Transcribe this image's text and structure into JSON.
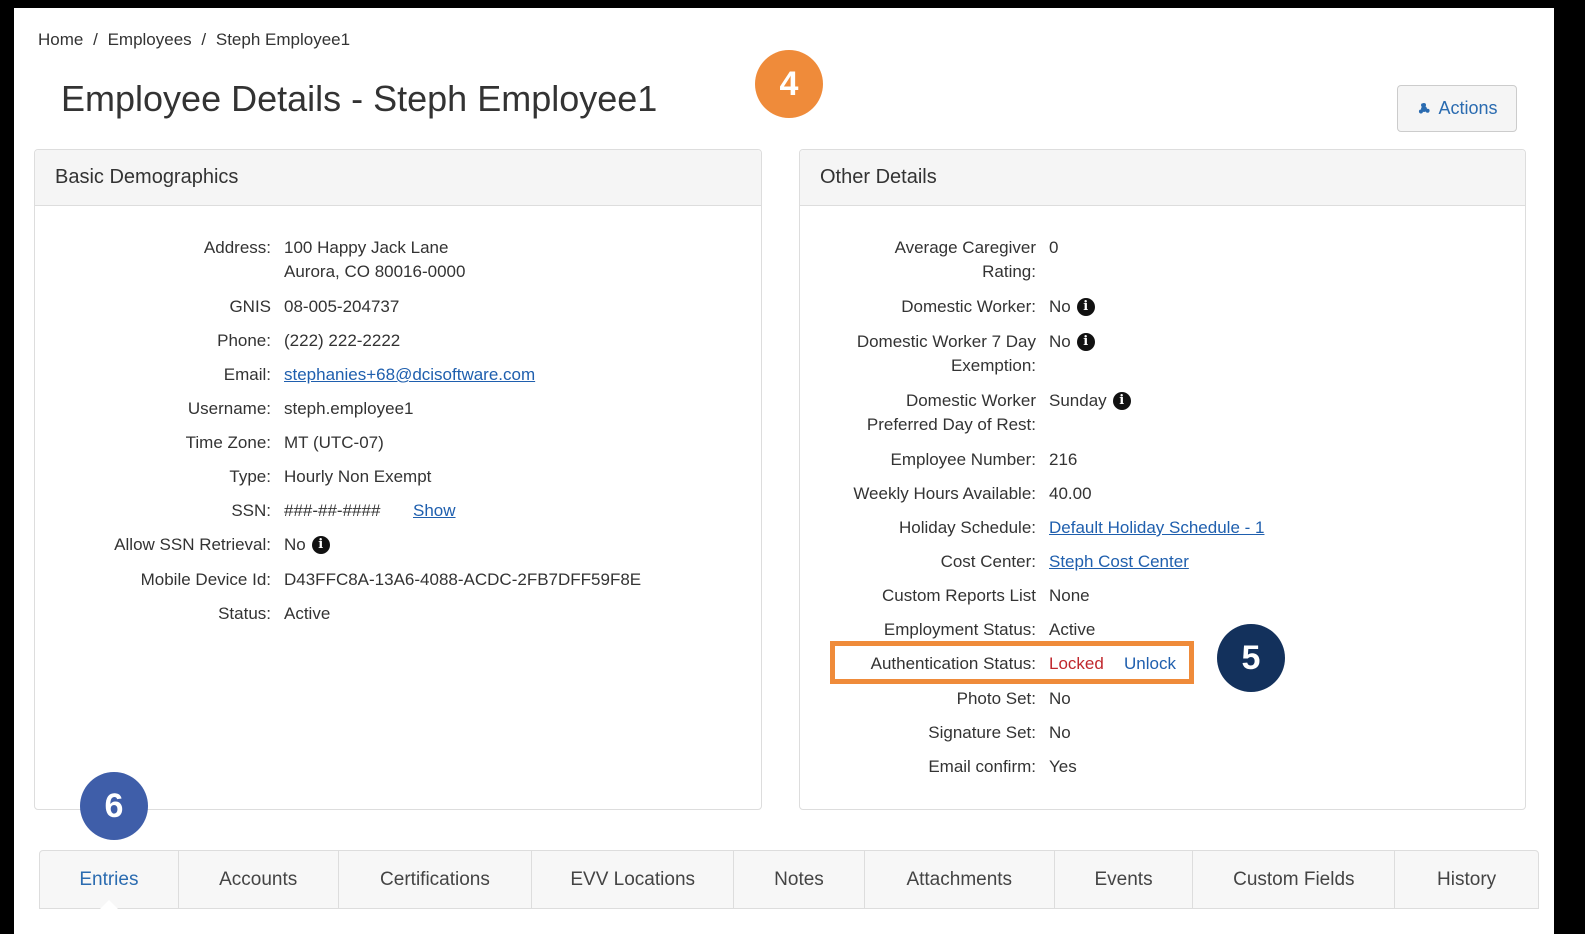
{
  "breadcrumb": [
    "Home",
    "/",
    "Employees",
    "/",
    "Steph Employee1"
  ],
  "page_title": "Employee Details - Steph Employee1",
  "actions_label": "Actions",
  "badges": {
    "four": "4",
    "five": "5",
    "six": "6"
  },
  "left_panel": {
    "title": "Basic Demographics",
    "address_label": "Address:",
    "address_line1": "100 Happy Jack Lane",
    "address_line2": "Aurora, CO 80016-0000",
    "gnis_label": "GNIS",
    "gnis_value": "08-005-204737",
    "phone_label": "Phone:",
    "phone_value": "(222) 222-2222",
    "email_label": "Email:",
    "email_value": "stephanies+68@dcisoftware.com",
    "username_label": "Username:",
    "username_value": "steph.employee1",
    "timezone_label": "Time Zone:",
    "timezone_value": "MT (UTC-07)",
    "type_label": "Type:",
    "type_value": "Hourly Non Exempt",
    "ssn_label": "SSN:",
    "ssn_value": "###-##-####",
    "ssn_show": "Show",
    "allow_ssn_label": "Allow SSN Retrieval:",
    "allow_ssn_value": "No",
    "mobile_label": "Mobile Device Id:",
    "mobile_value": "D43FFC8A-13A6-4088-ACDC-2FB7DFF59F8E",
    "status_label": "Status:",
    "status_value": "Active"
  },
  "right_panel": {
    "title": "Other Details",
    "avg_rating_label_1": "Average Caregiver",
    "avg_rating_label_2": "Rating:",
    "avg_rating_value": "0",
    "domestic_label": "Domestic Worker:",
    "domestic_value": "No",
    "dw7_label_1": "Domestic Worker 7 Day",
    "dw7_label_2": "Exemption:",
    "dw7_value": "No",
    "dwrest_label_1": "Domestic Worker",
    "dwrest_label_2": "Preferred Day of Rest:",
    "dwrest_value": "Sunday",
    "empnum_label": "Employee Number:",
    "empnum_value": "216",
    "weekly_label": "Weekly Hours Available:",
    "weekly_value": "40.00",
    "holiday_label": "Holiday Schedule:",
    "holiday_value": "Default Holiday Schedule - 1",
    "cost_label": "Cost Center:",
    "cost_value": "Steph Cost Center",
    "custom_reports_label": "Custom Reports List",
    "custom_reports_value": "None",
    "employment_label": "Employment Status:",
    "employment_value": "Active",
    "auth_label": "Authentication Status:",
    "auth_value": "Locked",
    "auth_unlock": "Unlock",
    "photo_label": "Photo Set:",
    "photo_value": "No",
    "signature_label": "Signature Set:",
    "signature_value": "No",
    "emailconf_label": "Email confirm:",
    "emailconf_value": "Yes"
  },
  "info_glyph": "i",
  "tabs": [
    "Entries",
    "Accounts",
    "Certifications",
    "EVV Locations",
    "Notes",
    "Attachments",
    "Events",
    "Custom Fields",
    "History"
  ],
  "colors": {
    "accent": "#2a6bb0",
    "locked": "#c0272d",
    "highlight": "#ef8b3a",
    "badge_dark": "#13315c",
    "badge_blue": "#3f5ea9"
  }
}
